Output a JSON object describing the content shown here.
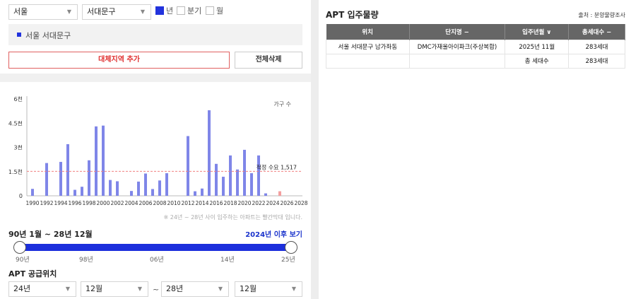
{
  "filters": {
    "sido": "서울",
    "sigungu": "서대문구",
    "period_options": [
      {
        "label": "년",
        "checked": true
      },
      {
        "label": "분기",
        "checked": false
      },
      {
        "label": "월",
        "checked": false
      }
    ]
  },
  "selected_region": "서울 서대문구",
  "buttons": {
    "add": "대체지역 추가",
    "clear": "전체삭제"
  },
  "chart_data": {
    "type": "bar",
    "title": "",
    "legend": "가구 수",
    "y_ticks": [
      "0",
      "1.5천",
      "3천",
      "4.5천",
      "6천"
    ],
    "ylim": [
      0,
      6000
    ],
    "x_ticks": [
      "1990",
      "1992",
      "1994",
      "1996",
      "1998",
      "2000",
      "2002",
      "2004",
      "2006",
      "2008",
      "2010",
      "2012",
      "2014",
      "2016",
      "2018",
      "2020",
      "2022",
      "2024",
      "2026",
      "2028"
    ],
    "xlim": [
      1989.2,
      2028.2
    ],
    "series": [
      {
        "values": [
          [
            1990,
            430
          ],
          [
            1992,
            2030
          ],
          [
            1994,
            2100
          ],
          [
            1995,
            3200
          ],
          [
            1996,
            370
          ],
          [
            1997,
            560
          ],
          [
            1998,
            2200
          ],
          [
            1999,
            4300
          ],
          [
            2000,
            4350
          ],
          [
            2001,
            980
          ],
          [
            2002,
            900
          ],
          [
            2004,
            300
          ],
          [
            2005,
            880
          ],
          [
            2006,
            1380
          ],
          [
            2007,
            420
          ],
          [
            2008,
            950
          ],
          [
            2009,
            1400
          ],
          [
            2012,
            3700
          ],
          [
            2013,
            280
          ],
          [
            2014,
            450
          ],
          [
            2015,
            5300
          ],
          [
            2016,
            1980
          ],
          [
            2017,
            1180
          ],
          [
            2018,
            2500
          ],
          [
            2019,
            1630
          ],
          [
            2020,
            2850
          ],
          [
            2021,
            1400
          ],
          [
            2022,
            2500
          ],
          [
            2023,
            150
          ]
        ],
        "color": "#7f86e8"
      },
      {
        "values": [
          [
            2025,
            283
          ]
        ],
        "color": "#f3a0a0"
      }
    ],
    "reference_line": {
      "value": 1517,
      "label": "적정 수요 1,517",
      "color": "#f08080"
    },
    "note": "※ 24년 ~ 28년 사이 입주하는 아파트는 빨간막대 입니다."
  },
  "range": {
    "title": "90년 1월 ~ 28년 12월",
    "link": "2024년 이후 보기",
    "ticks": [
      "90년",
      "98년",
      "06년",
      "14년",
      "25년"
    ]
  },
  "apt_location": {
    "label": "APT 공급위치",
    "from_year": "24년",
    "from_month": "12월",
    "tilde": "~",
    "to_year": "28년",
    "to_month": "12월"
  },
  "right": {
    "title": "APT 입주물량",
    "source": "출처 : 분양물량조사",
    "headers": [
      "위치",
      "단지명 −",
      "입주년월 ∨",
      "총세대수 −"
    ],
    "rows": [
      [
        "서울 서대문구 남가좌동",
        "DMC가재울아이파크(주상복합)",
        "2025년 11월",
        "283세대"
      ],
      [
        "",
        "",
        "총 세대수",
        "283세대"
      ]
    ]
  }
}
